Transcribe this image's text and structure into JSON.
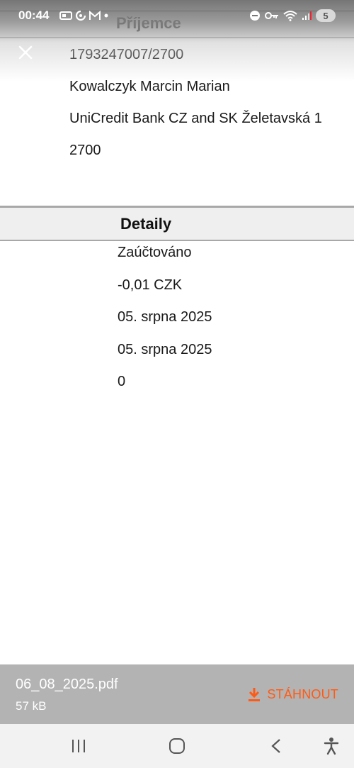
{
  "status_bar": {
    "time": "00:44",
    "battery_level": "5"
  },
  "recipient": {
    "title": "Příjemce",
    "account": "1793247007/2700",
    "name": "Kowalczyk Marcin Marian",
    "bank": "UniCredit Bank CZ and SK Želetavská 1",
    "bank_code": "2700"
  },
  "details": {
    "title": "Detaily",
    "status": "Zaúčtováno",
    "amount": "-0,01 CZK",
    "date_1": "05. srpna 2025",
    "date_2": "05. srpna 2025",
    "value": "0"
  },
  "file": {
    "name": "06_08_2025.pdf",
    "size": "57 kB",
    "download_label": "STÁHNOUT"
  },
  "colors": {
    "accent": "#ff5a14",
    "file_bar": "#b3b3b3",
    "section_bar": "#efefef"
  },
  "icons": {
    "close": "close-icon",
    "download": "download-icon",
    "nav_recents": "recents-icon",
    "nav_home": "home-icon",
    "nav_back": "back-icon",
    "accessibility": "accessibility-icon"
  }
}
